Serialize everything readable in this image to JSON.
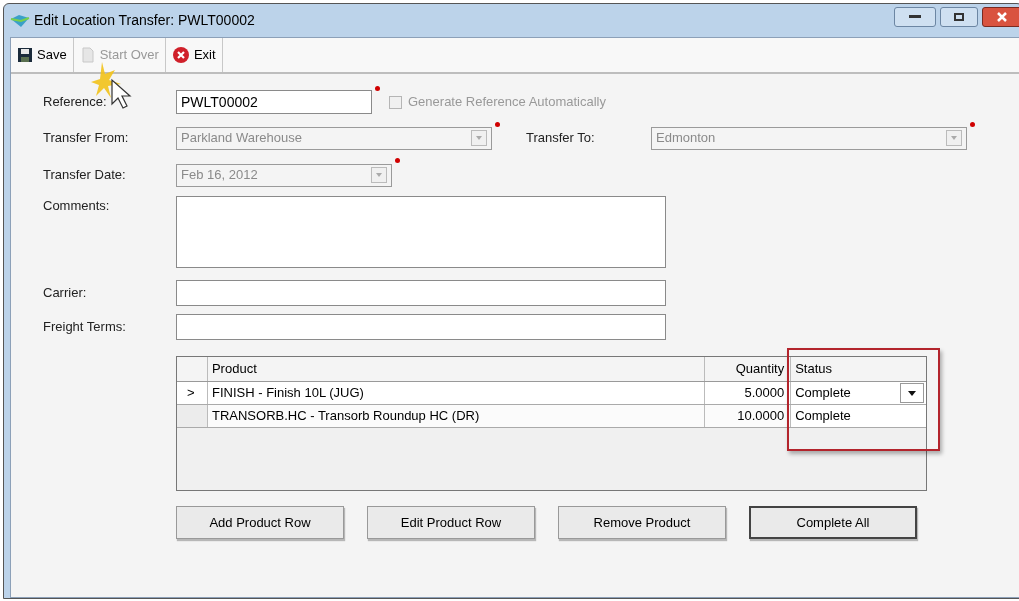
{
  "window": {
    "title": "Edit Location Transfer: PWLT00002"
  },
  "toolbar": [
    {
      "label": "Save",
      "kind": "save",
      "disabled": false
    },
    {
      "label": "Start Over",
      "kind": "page",
      "disabled": true
    },
    {
      "label": "Exit",
      "kind": "exit",
      "disabled": false
    }
  ],
  "reference": {
    "label": "Reference:",
    "value": "PWLT00002",
    "required": true,
    "generate": {
      "label": "Generate Reference Automatically",
      "checked": false,
      "disabled": true
    }
  },
  "transfer_from": {
    "label": "Transfer From:",
    "value": "Parkland Warehouse",
    "disabled": true,
    "required": true
  },
  "transfer_to": {
    "label": "Transfer To:",
    "value": "Edmonton",
    "disabled": true,
    "required": true
  },
  "transfer_date": {
    "label": "Transfer Date:",
    "value": "Feb 16, 2012",
    "disabled": true,
    "required": true
  },
  "comments": {
    "label": "Comments:"
  },
  "carrier": {
    "label": "Carrier:"
  },
  "freight_terms": {
    "label": "Freight Terms:"
  },
  "grid": {
    "columns": [
      "Product",
      "Quantity",
      "Status"
    ],
    "rows": [
      {
        "marker": ">",
        "selected": true,
        "product": "FINISH - Finish 10L (JUG)",
        "quantity": "5.0000",
        "status": "Complete",
        "editing": true
      },
      {
        "selected": false,
        "product": "TRANSORB.HC - Transorb Roundup HC (DR)",
        "quantity": "10.0000",
        "status": "Complete",
        "editing": false
      }
    ],
    "highlight_status": true
  },
  "buttons": [
    {
      "label": "Add Product Row",
      "default": false
    },
    {
      "label": "Edit Product Row",
      "default": false
    },
    {
      "label": "Remove Product",
      "default": false
    },
    {
      "label": "Complete All",
      "default": true
    }
  ]
}
